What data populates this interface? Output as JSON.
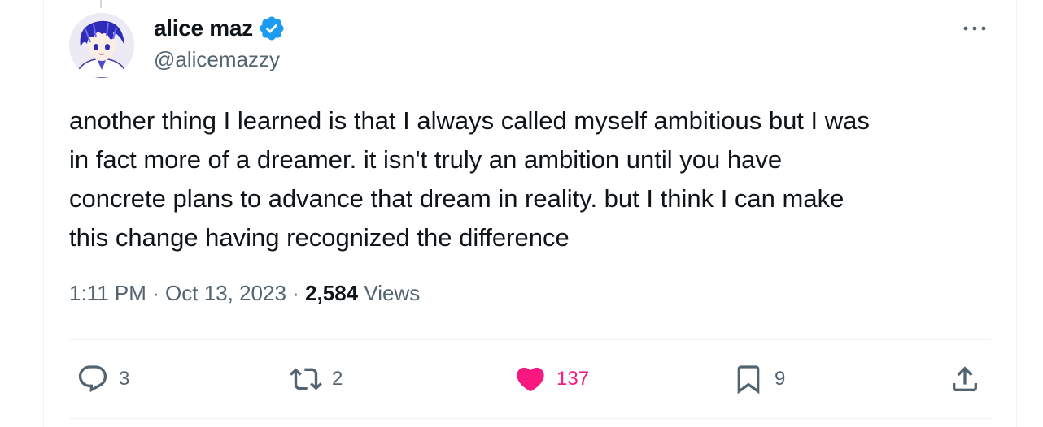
{
  "author": {
    "display_name": "alice maz",
    "handle": "@alicemazzy",
    "verified": true,
    "verified_color": "#1d9bf0"
  },
  "tweet": {
    "text_lines": [
      "another thing I learned is that I always called myself ambitious but I was",
      "in fact more of a dreamer. it isn't truly an ambition until you have",
      "concrete plans to advance that dream in reality. but I think I can make",
      "this change having recognized the difference"
    ]
  },
  "meta": {
    "time": "1:11 PM",
    "separator": "·",
    "date": "Oct 13, 2023",
    "views_count": "2,584",
    "views_label": "Views"
  },
  "actions": {
    "replies": "3",
    "retweets": "2",
    "likes": "137",
    "bookmarks": "9"
  },
  "icons": {
    "reply": "reply-icon",
    "retweet": "retweet-icon",
    "like": "heart-icon",
    "bookmark": "bookmark-icon",
    "share": "share-icon",
    "more": "more-icon"
  },
  "colors": {
    "text": "#0f1419",
    "secondary": "#536471",
    "like_active": "#f91880",
    "verified": "#1d9bf0"
  }
}
